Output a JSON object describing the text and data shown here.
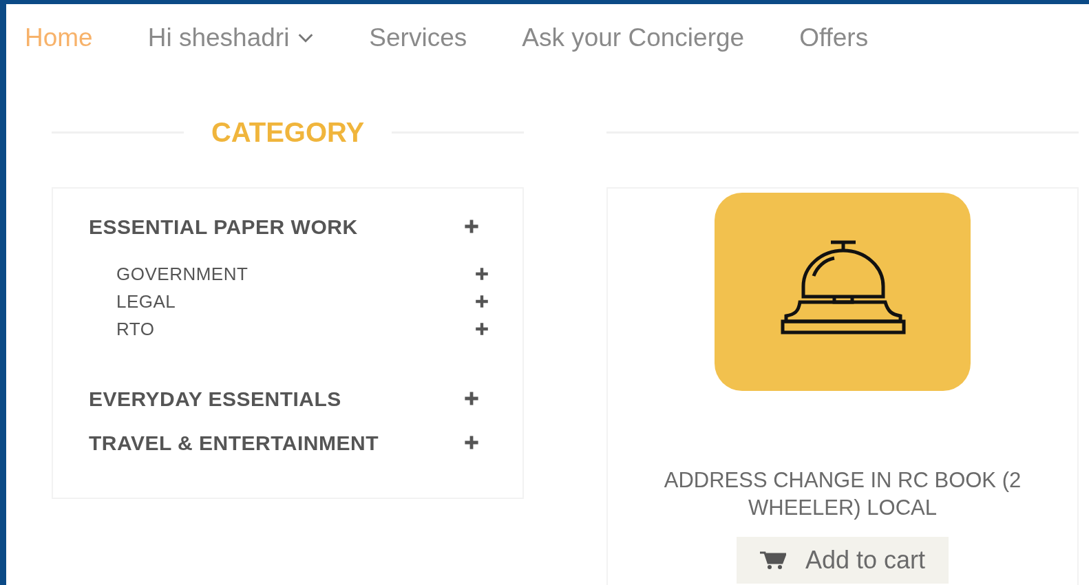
{
  "nav": [
    {
      "label": "Home",
      "selected": true,
      "kind": "link"
    },
    {
      "label": "Hi sheshadri",
      "selected": false,
      "kind": "dropdown"
    },
    {
      "label": "Services",
      "selected": false,
      "kind": "link"
    },
    {
      "label": "Ask your Concierge",
      "selected": false,
      "kind": "link"
    },
    {
      "label": "Offers",
      "selected": false,
      "kind": "link"
    }
  ],
  "category": {
    "title": "CATEGORY",
    "items": [
      {
        "label": "ESSENTIAL PAPER WORK",
        "children": [
          {
            "label": "GOVERNMENT"
          },
          {
            "label": "LEGAL"
          },
          {
            "label": "RTO"
          }
        ]
      },
      {
        "label": "EVERYDAY ESSENTIALS"
      },
      {
        "label": "TRAVEL & ENTERTAINMENT"
      }
    ]
  },
  "product": {
    "title": "ADDRESS CHANGE IN RC BOOK (2 WHEELER) LOCAL",
    "button": "Add to cart"
  }
}
